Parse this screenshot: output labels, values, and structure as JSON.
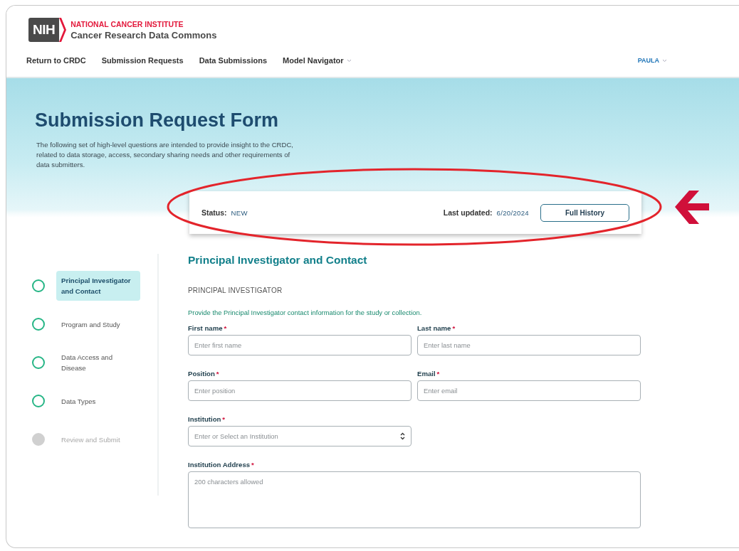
{
  "header": {
    "logo_text": "NIH",
    "agency": "NATIONAL CANCER INSTITUTE",
    "title": "Cancer Research Data Commons"
  },
  "nav": {
    "items": [
      {
        "label": "Return to CRDC",
        "menu": false
      },
      {
        "label": "Submission Requests",
        "menu": false
      },
      {
        "label": "Data Submissions",
        "menu": false
      },
      {
        "label": "Model Navigator",
        "menu": true
      }
    ],
    "user": {
      "label": "PAULA",
      "menu": true
    }
  },
  "hero": {
    "title": "Submission Request Form",
    "description": "The following set of high-level questions are intended to provide insight to the CRDC, related to data storage, access, secondary sharing needs and other requirements of data submitters."
  },
  "status_card": {
    "status_label": "Status:",
    "status_value": "NEW",
    "updated_label": "Last updated:",
    "updated_value": "6/20/2024",
    "button": "Full History"
  },
  "sidebar": {
    "items": [
      {
        "label": "Principal Investigator and Contact",
        "selected": true,
        "disabled": false
      },
      {
        "label": "Program and Study",
        "selected": false,
        "disabled": false
      },
      {
        "label": "Data Access and Disease",
        "selected": false,
        "disabled": false
      },
      {
        "label": "Data Types",
        "selected": false,
        "disabled": false
      },
      {
        "label": "Review and Submit",
        "selected": false,
        "disabled": true
      }
    ]
  },
  "section": {
    "title": "Principal Investigator and Contact",
    "subheading": "PRINCIPAL INVESTIGATOR",
    "instruction": "Provide the Principal Investigator contact information for the study or collection.",
    "fields": [
      {
        "label": "First name",
        "required_mark": "*",
        "placeholder": "Enter first name",
        "kind": "text"
      },
      {
        "label": "Last name",
        "required_mark": "*",
        "placeholder": "Enter last name",
        "kind": "text"
      },
      {
        "label": "Position",
        "required_mark": "*",
        "placeholder": "Enter position",
        "kind": "text"
      },
      {
        "label": "Email",
        "required_mark": "*",
        "placeholder": "Enter email",
        "kind": "text"
      },
      {
        "label": "Institution",
        "required_mark": "*",
        "placeholder": "Enter or Select an Institution",
        "kind": "select"
      },
      {
        "label": "Institution Address",
        "required_mark": "*",
        "placeholder": "200 characters allowed",
        "kind": "textarea"
      }
    ]
  }
}
